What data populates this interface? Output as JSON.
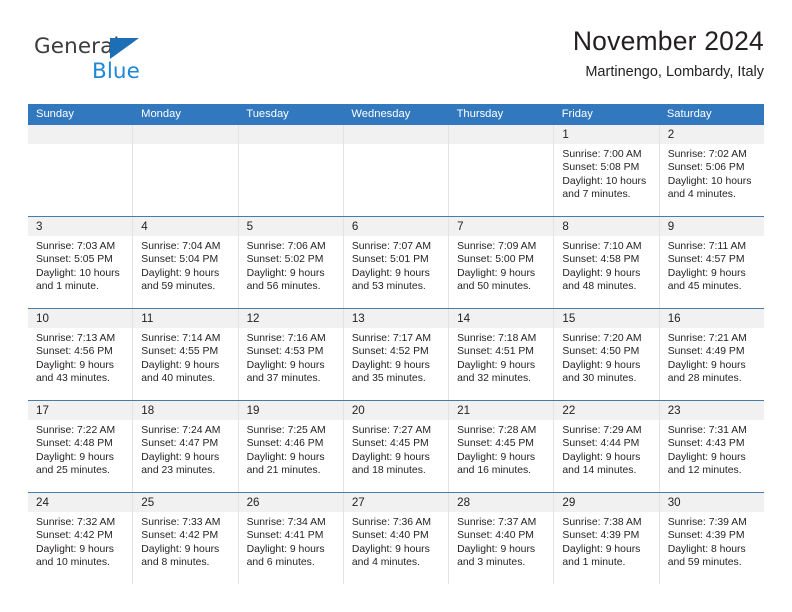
{
  "brand": {
    "name_part1": "General",
    "name_part2": "Blue",
    "triangle_color": "#1c6fb5",
    "blue_color": "#1e88d8"
  },
  "header": {
    "title": "November 2024",
    "location": "Martinengo, Lombardy, Italy"
  },
  "theme": {
    "header_row_bg": "#3178be",
    "header_row_text": "#ffffff",
    "daynum_row_bg": "#f1f1f1",
    "week_divider": "#4a7aa8",
    "cell_divider": "#e3e3e3",
    "text": "#231f20"
  },
  "weekdays": [
    "Sunday",
    "Monday",
    "Tuesday",
    "Wednesday",
    "Thursday",
    "Friday",
    "Saturday"
  ],
  "weeks": [
    {
      "days": [
        {
          "num": "",
          "lines": []
        },
        {
          "num": "",
          "lines": []
        },
        {
          "num": "",
          "lines": []
        },
        {
          "num": "",
          "lines": []
        },
        {
          "num": "",
          "lines": []
        },
        {
          "num": "1",
          "lines": [
            "Sunrise: 7:00 AM",
            "Sunset: 5:08 PM",
            "Daylight: 10 hours",
            "and 7 minutes."
          ]
        },
        {
          "num": "2",
          "lines": [
            "Sunrise: 7:02 AM",
            "Sunset: 5:06 PM",
            "Daylight: 10 hours",
            "and 4 minutes."
          ]
        }
      ]
    },
    {
      "days": [
        {
          "num": "3",
          "lines": [
            "Sunrise: 7:03 AM",
            "Sunset: 5:05 PM",
            "Daylight: 10 hours",
            "and 1 minute."
          ]
        },
        {
          "num": "4",
          "lines": [
            "Sunrise: 7:04 AM",
            "Sunset: 5:04 PM",
            "Daylight: 9 hours",
            "and 59 minutes."
          ]
        },
        {
          "num": "5",
          "lines": [
            "Sunrise: 7:06 AM",
            "Sunset: 5:02 PM",
            "Daylight: 9 hours",
            "and 56 minutes."
          ]
        },
        {
          "num": "6",
          "lines": [
            "Sunrise: 7:07 AM",
            "Sunset: 5:01 PM",
            "Daylight: 9 hours",
            "and 53 minutes."
          ]
        },
        {
          "num": "7",
          "lines": [
            "Sunrise: 7:09 AM",
            "Sunset: 5:00 PM",
            "Daylight: 9 hours",
            "and 50 minutes."
          ]
        },
        {
          "num": "8",
          "lines": [
            "Sunrise: 7:10 AM",
            "Sunset: 4:58 PM",
            "Daylight: 9 hours",
            "and 48 minutes."
          ]
        },
        {
          "num": "9",
          "lines": [
            "Sunrise: 7:11 AM",
            "Sunset: 4:57 PM",
            "Daylight: 9 hours",
            "and 45 minutes."
          ]
        }
      ]
    },
    {
      "days": [
        {
          "num": "10",
          "lines": [
            "Sunrise: 7:13 AM",
            "Sunset: 4:56 PM",
            "Daylight: 9 hours",
            "and 43 minutes."
          ]
        },
        {
          "num": "11",
          "lines": [
            "Sunrise: 7:14 AM",
            "Sunset: 4:55 PM",
            "Daylight: 9 hours",
            "and 40 minutes."
          ]
        },
        {
          "num": "12",
          "lines": [
            "Sunrise: 7:16 AM",
            "Sunset: 4:53 PM",
            "Daylight: 9 hours",
            "and 37 minutes."
          ]
        },
        {
          "num": "13",
          "lines": [
            "Sunrise: 7:17 AM",
            "Sunset: 4:52 PM",
            "Daylight: 9 hours",
            "and 35 minutes."
          ]
        },
        {
          "num": "14",
          "lines": [
            "Sunrise: 7:18 AM",
            "Sunset: 4:51 PM",
            "Daylight: 9 hours",
            "and 32 minutes."
          ]
        },
        {
          "num": "15",
          "lines": [
            "Sunrise: 7:20 AM",
            "Sunset: 4:50 PM",
            "Daylight: 9 hours",
            "and 30 minutes."
          ]
        },
        {
          "num": "16",
          "lines": [
            "Sunrise: 7:21 AM",
            "Sunset: 4:49 PM",
            "Daylight: 9 hours",
            "and 28 minutes."
          ]
        }
      ]
    },
    {
      "days": [
        {
          "num": "17",
          "lines": [
            "Sunrise: 7:22 AM",
            "Sunset: 4:48 PM",
            "Daylight: 9 hours",
            "and 25 minutes."
          ]
        },
        {
          "num": "18",
          "lines": [
            "Sunrise: 7:24 AM",
            "Sunset: 4:47 PM",
            "Daylight: 9 hours",
            "and 23 minutes."
          ]
        },
        {
          "num": "19",
          "lines": [
            "Sunrise: 7:25 AM",
            "Sunset: 4:46 PM",
            "Daylight: 9 hours",
            "and 21 minutes."
          ]
        },
        {
          "num": "20",
          "lines": [
            "Sunrise: 7:27 AM",
            "Sunset: 4:45 PM",
            "Daylight: 9 hours",
            "and 18 minutes."
          ]
        },
        {
          "num": "21",
          "lines": [
            "Sunrise: 7:28 AM",
            "Sunset: 4:45 PM",
            "Daylight: 9 hours",
            "and 16 minutes."
          ]
        },
        {
          "num": "22",
          "lines": [
            "Sunrise: 7:29 AM",
            "Sunset: 4:44 PM",
            "Daylight: 9 hours",
            "and 14 minutes."
          ]
        },
        {
          "num": "23",
          "lines": [
            "Sunrise: 7:31 AM",
            "Sunset: 4:43 PM",
            "Daylight: 9 hours",
            "and 12 minutes."
          ]
        }
      ]
    },
    {
      "days": [
        {
          "num": "24",
          "lines": [
            "Sunrise: 7:32 AM",
            "Sunset: 4:42 PM",
            "Daylight: 9 hours",
            "and 10 minutes."
          ]
        },
        {
          "num": "25",
          "lines": [
            "Sunrise: 7:33 AM",
            "Sunset: 4:42 PM",
            "Daylight: 9 hours",
            "and 8 minutes."
          ]
        },
        {
          "num": "26",
          "lines": [
            "Sunrise: 7:34 AM",
            "Sunset: 4:41 PM",
            "Daylight: 9 hours",
            "and 6 minutes."
          ]
        },
        {
          "num": "27",
          "lines": [
            "Sunrise: 7:36 AM",
            "Sunset: 4:40 PM",
            "Daylight: 9 hours",
            "and 4 minutes."
          ]
        },
        {
          "num": "28",
          "lines": [
            "Sunrise: 7:37 AM",
            "Sunset: 4:40 PM",
            "Daylight: 9 hours",
            "and 3 minutes."
          ]
        },
        {
          "num": "29",
          "lines": [
            "Sunrise: 7:38 AM",
            "Sunset: 4:39 PM",
            "Daylight: 9 hours",
            "and 1 minute."
          ]
        },
        {
          "num": "30",
          "lines": [
            "Sunrise: 7:39 AM",
            "Sunset: 4:39 PM",
            "Daylight: 8 hours",
            "and 59 minutes."
          ]
        }
      ]
    }
  ]
}
